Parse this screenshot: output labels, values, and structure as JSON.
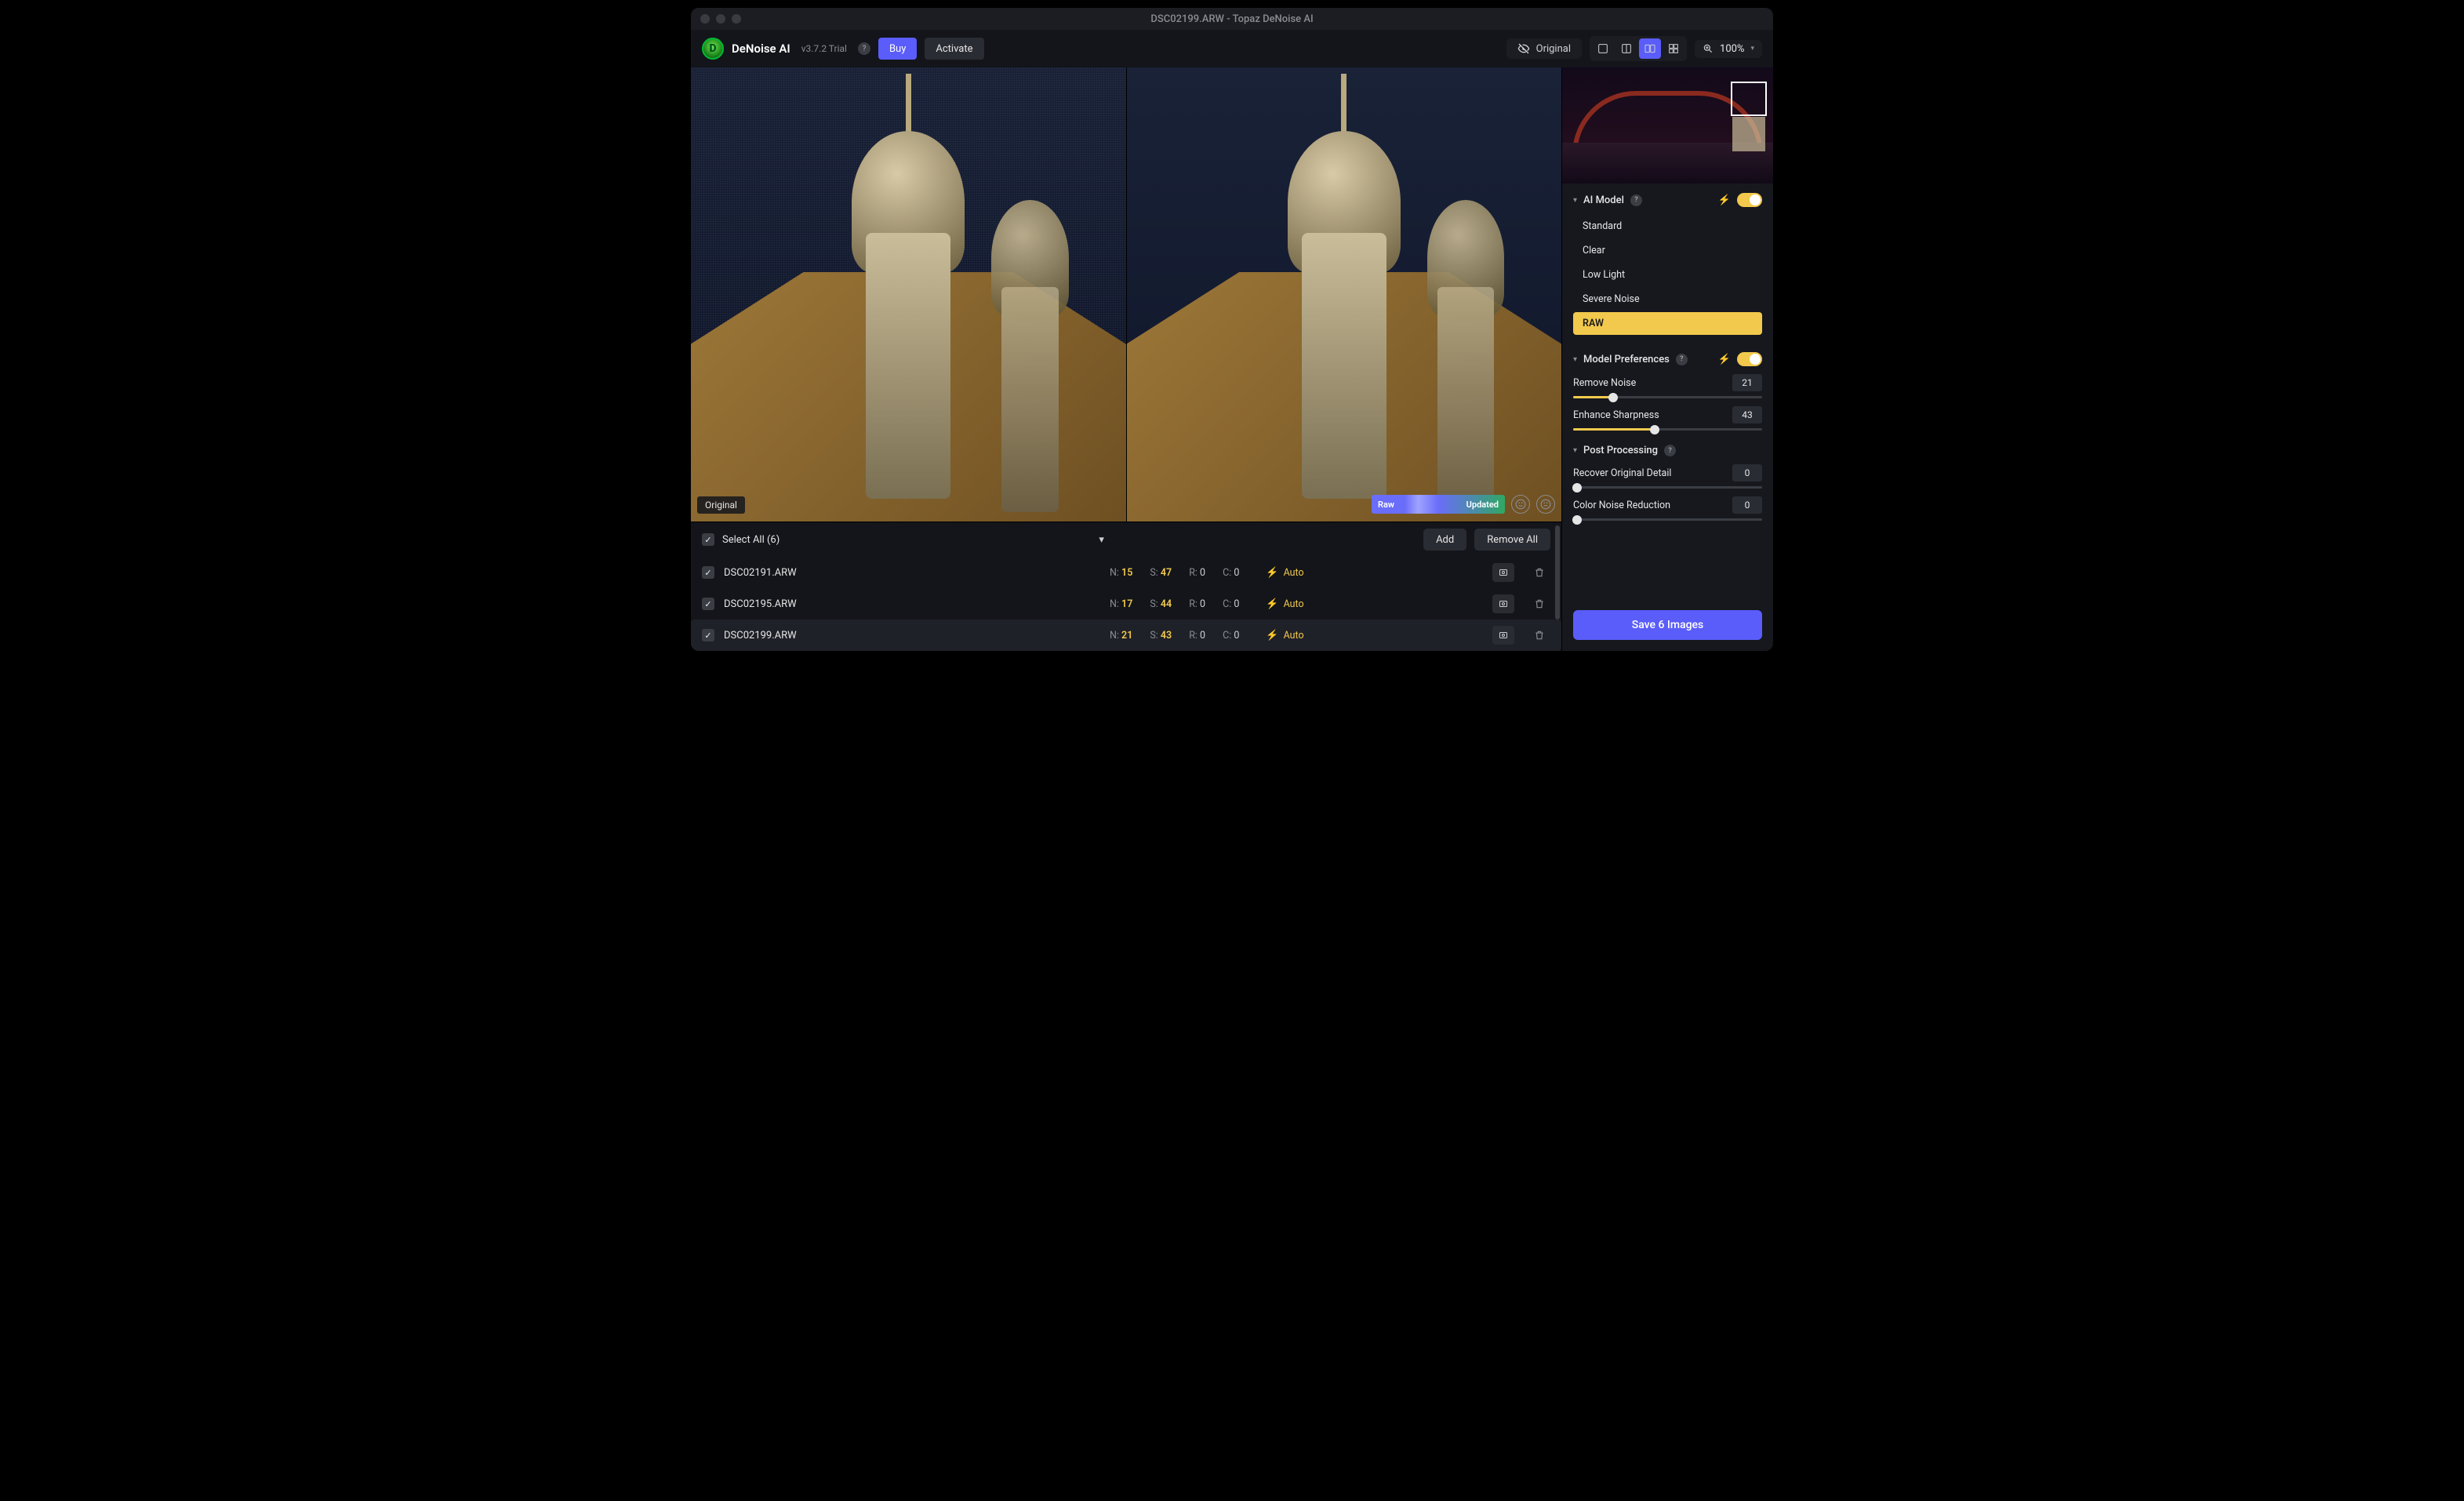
{
  "titlebar": {
    "title": "DSC02199.ARW - Topaz DeNoise AI"
  },
  "toolbar": {
    "app_name": "DeNoise AI",
    "version": "v3.7.2 Trial",
    "buy": "Buy",
    "activate": "Activate",
    "original": "Original",
    "zoom": "100%"
  },
  "viewer": {
    "left_label": "Original",
    "bar_left": "Raw",
    "bar_right": "Updated"
  },
  "filearea": {
    "select_all": "Select All (6)",
    "add": "Add",
    "remove_all": "Remove All",
    "auto": "Auto",
    "rows": [
      {
        "name": "DSC02191.ARW",
        "n": "15",
        "s": "47",
        "r": "0",
        "c": "0",
        "selected": false
      },
      {
        "name": "DSC02195.ARW",
        "n": "17",
        "s": "44",
        "r": "0",
        "c": "0",
        "selected": false
      },
      {
        "name": "DSC02199.ARW",
        "n": "21",
        "s": "43",
        "r": "0",
        "c": "0",
        "selected": true
      }
    ],
    "labels": {
      "n": "N:",
      "s": "S:",
      "r": "R:",
      "c": "C:"
    }
  },
  "panel": {
    "ai_model": {
      "title": "AI Model",
      "options": [
        "Standard",
        "Clear",
        "Low Light",
        "Severe Noise",
        "RAW"
      ],
      "selected": "RAW"
    },
    "model_prefs": {
      "title": "Model Preferences",
      "remove_noise": {
        "label": "Remove Noise",
        "value": "21",
        "pct": 21
      },
      "enhance_sharp": {
        "label": "Enhance Sharpness",
        "value": "43",
        "pct": 43
      }
    },
    "post": {
      "title": "Post Processing",
      "recover": {
        "label": "Recover Original Detail",
        "value": "0",
        "pct": 0
      },
      "color_nr": {
        "label": "Color Noise Reduction",
        "value": "0",
        "pct": 0
      }
    },
    "save": "Save 6 Images"
  }
}
